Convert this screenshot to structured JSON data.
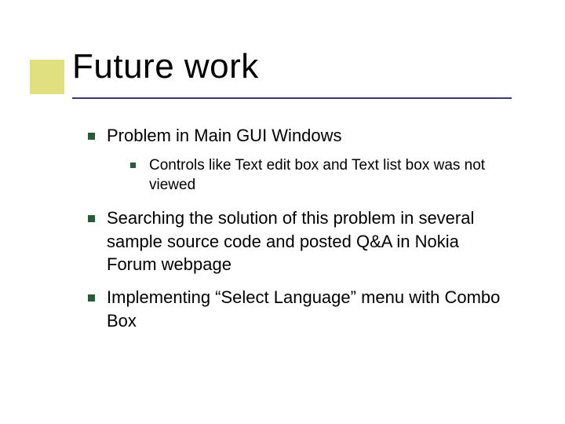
{
  "title": "Future work",
  "bullets": {
    "b1": "Problem in Main GUI Windows",
    "b1_1": "Controls like Text edit box and Text list box was not viewed",
    "b2": "Searching the solution of this problem in several sample source code and posted Q&A in Nokia Forum webpage",
    "b3": "Implementing “Select Language” menu with Combo Box"
  }
}
